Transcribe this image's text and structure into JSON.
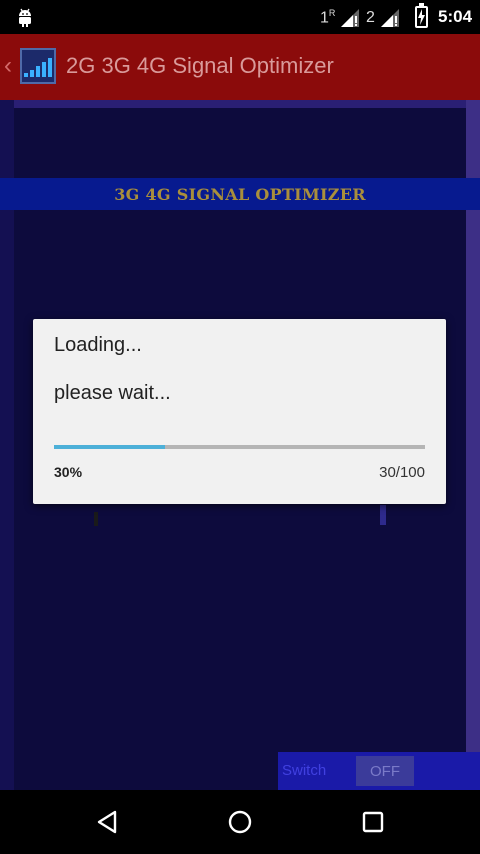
{
  "status_bar": {
    "sim1_label": "1",
    "sim1_roaming": "R",
    "sim2_label": "2",
    "battery_icon": "battery-charging-icon",
    "time": "5:04"
  },
  "action_bar": {
    "title": "2G 3G 4G Signal Optimizer",
    "color": "#8b0b0b"
  },
  "content": {
    "banner": "3G 4G SIGNAL OPTIMIZER",
    "background": "#0d0b3d"
  },
  "dialog": {
    "title": "Loading...",
    "message": "please wait...",
    "progress": 0.3,
    "progress_percent_text": "30%",
    "progress_count_text": "30/100",
    "progress_color": "#4db0d8"
  },
  "bottom_strip": {
    "label": "Switch",
    "toggle": "OFF"
  },
  "nav_bar": {
    "back": "back-icon",
    "home": "home-icon",
    "recents": "recents-icon"
  }
}
